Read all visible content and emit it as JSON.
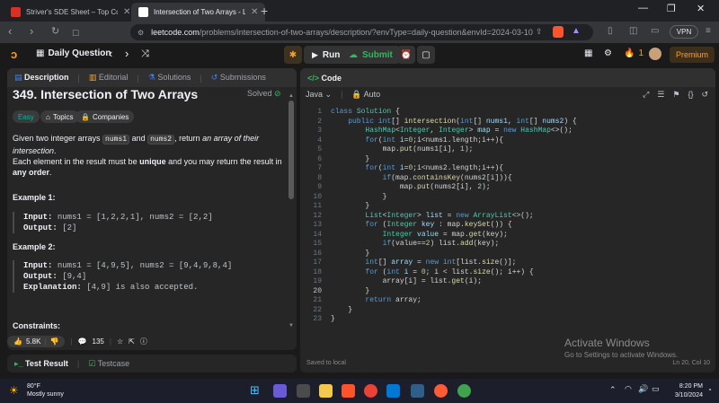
{
  "browser": {
    "tabs": [
      {
        "title": "Striver's SDE Sheet – Top Coding Inte",
        "color": "#d93025"
      },
      {
        "title": "Intersection of Two Arrays - LeetC",
        "color": "#3b3b3b"
      }
    ],
    "url_host": "leetcode.com",
    "url_path": "/problems/intersection-of-two-arrays/description/?envType=daily-question&envId=2024-03-10",
    "vpn": "VPN"
  },
  "lc": {
    "daily": "Daily Question",
    "run": "Run",
    "submit": "Submit",
    "streak": "1",
    "premium": "Premium"
  },
  "left": {
    "tabs": [
      "Description",
      "Editorial",
      "Solutions",
      "Submissions"
    ],
    "title": "349. Intersection of Two Arrays",
    "solved": "Solved",
    "chips": [
      "Easy",
      "Topics",
      "Companies"
    ],
    "p1_a": "Given two integer arrays ",
    "p1_code1": "nums1",
    "p1_b": " and ",
    "p1_code2": "nums2",
    "p1_c": ", return ",
    "p1_em": "an array of their intersection",
    "p1_d": ".",
    "p2_a": "Each element in the result must be ",
    "p2_b1": "unique",
    "p2_b": " and you may return the result in ",
    "p2_b2": "any order",
    "p2_c": ".",
    "ex1_h": "Example 1:",
    "ex1_in_label": "Input:",
    "ex1_in": "nums1 = [1,2,2,1], nums2 = [2,2]",
    "ex1_out_label": "Output:",
    "ex1_out": "[2]",
    "ex2_h": "Example 2:",
    "ex2_in_label": "Input:",
    "ex2_in": "nums1 = [4,9,5], nums2 = [9,4,9,8,4]",
    "ex2_out_label": "Output:",
    "ex2_out": "[9,4]",
    "ex2_exp_label": "Explanation:",
    "ex2_exp": "[4,9] is also accepted.",
    "constraints": "Constraints:",
    "likes": "5.8K",
    "comments": "135"
  },
  "testbar": {
    "result": "Test Result",
    "testcase": "Testcase"
  },
  "code": {
    "header": "Code",
    "lang": "Java",
    "mode": "Auto",
    "status": "Saved to local",
    "cursor": "Ln 20, Col 10"
  },
  "watermark": {
    "a": "Activate Windows",
    "b": "Go to Settings to activate Windows."
  },
  "taskbar": {
    "temp": "80°F",
    "weather": "Mostly sunny",
    "time": "8:20 PM",
    "date": "3/10/2024"
  }
}
